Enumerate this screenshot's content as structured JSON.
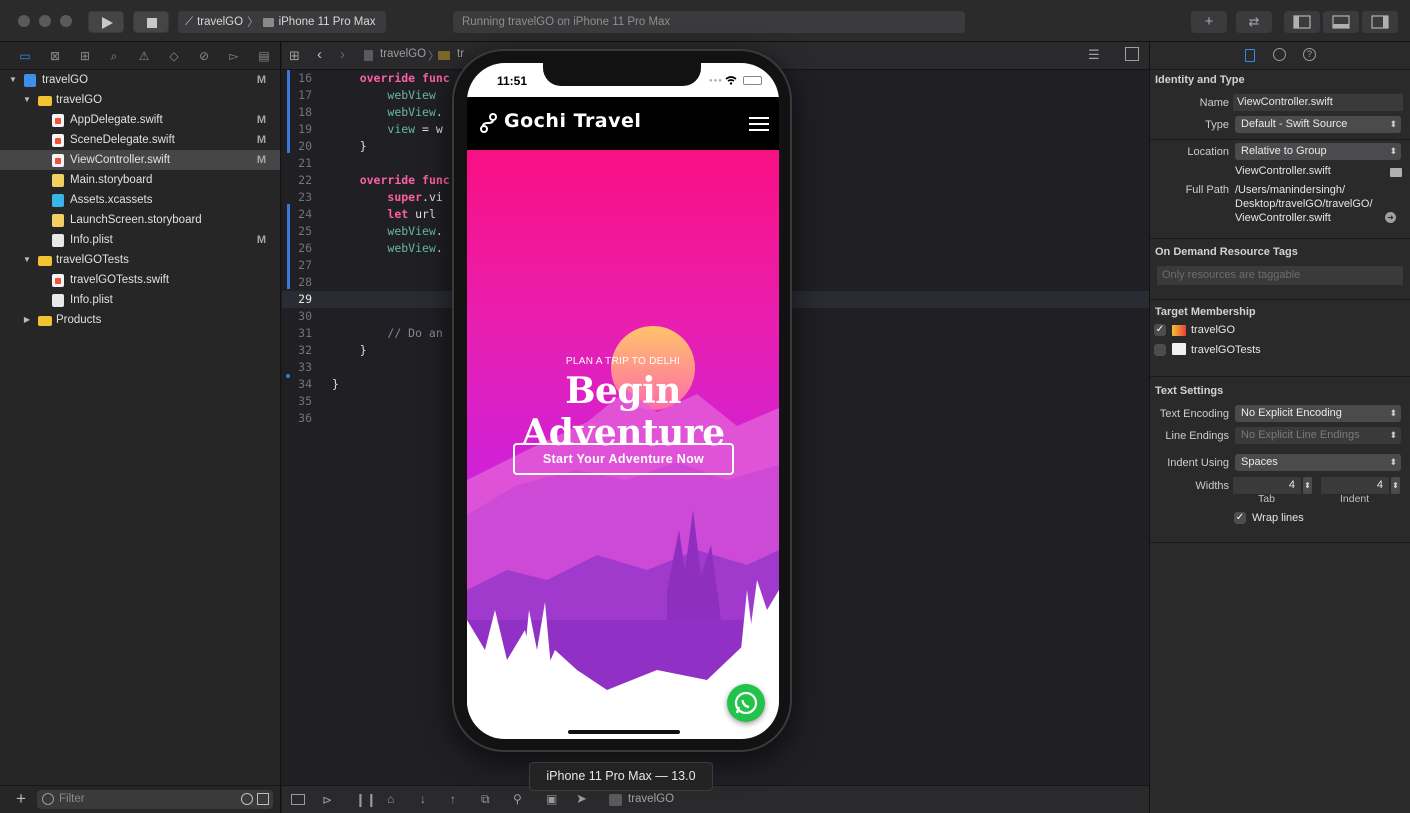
{
  "toolbar": {
    "scheme_project": "travelGO",
    "scheme_device": "iPhone 11 Pro Max",
    "activity_text": "Running travelGO on iPhone 11 Pro Max",
    "library_icon": "plus-icon",
    "review_icon": "arrows-swap-icon"
  },
  "navigator": {
    "tree": [
      {
        "label": "travelGO",
        "indent": 0,
        "icon": "project-icon",
        "expanded": true,
        "badge": "M",
        "selected": false
      },
      {
        "label": "travelGO",
        "indent": 1,
        "icon": "folder-icon",
        "expanded": true,
        "badge": "",
        "selected": false
      },
      {
        "label": "AppDelegate.swift",
        "indent": 2,
        "icon": "swift-file-icon",
        "badge": "M",
        "selected": false
      },
      {
        "label": "SceneDelegate.swift",
        "indent": 2,
        "icon": "swift-file-icon",
        "badge": "M",
        "selected": false
      },
      {
        "label": "ViewController.swift",
        "indent": 2,
        "icon": "swift-file-icon",
        "badge": "M",
        "selected": true
      },
      {
        "label": "Main.storyboard",
        "indent": 2,
        "icon": "storyboard-file-icon",
        "badge": "",
        "selected": false
      },
      {
        "label": "Assets.xcassets",
        "indent": 2,
        "icon": "assets-folder-icon",
        "badge": "",
        "selected": false
      },
      {
        "label": "LaunchScreen.storyboard",
        "indent": 2,
        "icon": "storyboard-file-icon",
        "badge": "",
        "selected": false
      },
      {
        "label": "Info.plist",
        "indent": 2,
        "icon": "plist-file-icon",
        "badge": "M",
        "selected": false
      },
      {
        "label": "travelGOTests",
        "indent": 1,
        "icon": "folder-icon",
        "expanded": true,
        "badge": "",
        "selected": false
      },
      {
        "label": "travelGOTests.swift",
        "indent": 2,
        "icon": "swift-file-icon",
        "badge": "",
        "selected": false
      },
      {
        "label": "Info.plist",
        "indent": 2,
        "icon": "plist-file-icon",
        "badge": "",
        "selected": false
      },
      {
        "label": "Products",
        "indent": 1,
        "icon": "folder-icon",
        "expanded": false,
        "badge": "",
        "selected": false
      }
    ],
    "filter_placeholder": "Filter"
  },
  "editor": {
    "jump_bar": [
      "travelGO",
      "tr"
    ],
    "current_line": 29,
    "lines": [
      {
        "no": "16",
        "html": "    <span class=\"kw\">override</span> <span class=\"kw\">func</span>"
      },
      {
        "no": "17",
        "html": "        <span class=\"ty\">webView</span>"
      },
      {
        "no": "18",
        "html": "        <span class=\"ty\">webView</span>."
      },
      {
        "no": "19",
        "html": "        <span class=\"ty\">view</span> = w"
      },
      {
        "no": "20",
        "html": "    }"
      },
      {
        "no": "21",
        "html": ""
      },
      {
        "no": "22",
        "html": "    <span class=\"kw\">override</span> <span class=\"kw\">func</span>"
      },
      {
        "no": "23",
        "html": "        <span class=\"kw\">super</span>.vi"
      },
      {
        "no": "24",
        "html": "        <span class=\"kw\">let</span> url                                                 )!"
      },
      {
        "no": "25",
        "html": "        <span class=\"ty\">webView</span>."
      },
      {
        "no": "26",
        "html": "        <span class=\"ty\">webView</span>."
      },
      {
        "no": "27",
        "html": ""
      },
      {
        "no": "28",
        "html": ""
      },
      {
        "no": "29",
        "html": ""
      },
      {
        "no": "30",
        "html": ""
      },
      {
        "no": "31",
        "html": "        <span class=\"cm\">// Do an</span>"
      },
      {
        "no": "32",
        "html": "    }"
      },
      {
        "no": "33",
        "html": ""
      },
      {
        "no": "34",
        "html": "}"
      },
      {
        "no": "35",
        "html": ""
      },
      {
        "no": "36",
        "html": ""
      }
    ],
    "debug_target": "travelGO"
  },
  "simulator": {
    "time": "11:51",
    "app_title": "Gochi Travel",
    "hero_subtitle": "PLAN A TRIP TO DELHI",
    "hero_title": "Begin Adventure",
    "hero_button": "Start Your Adventure Now",
    "device_label": "iPhone 11 Pro Max — 13.0",
    "colors": {
      "header_bg": "#000000",
      "gradient_top": "#f90f83",
      "gradient_bottom": "#8b1ec4",
      "whatsapp": "#22c24b"
    }
  },
  "inspector": {
    "identity_title": "Identity and Type",
    "name_label": "Name",
    "name_value": "ViewController.swift",
    "type_label": "Type",
    "type_value": "Default - Swift Source",
    "location_label": "Location",
    "location_value": "Relative to Group",
    "location_file": "ViewController.swift",
    "full_path_label": "Full Path",
    "full_path_value": [
      "/Users/manindersingh/",
      "Desktop/travelGO/travelGO/",
      "ViewController.swift"
    ],
    "odr_title": "On Demand Resource Tags",
    "odr_placeholder": "Only resources are taggable",
    "target_title": "Target Membership",
    "targets": [
      {
        "name": "travelGO",
        "checked": true
      },
      {
        "name": "travelGOTests",
        "checked": false
      }
    ],
    "text_settings_title": "Text Settings",
    "encoding_label": "Text Encoding",
    "encoding_value": "No Explicit Encoding",
    "line_endings_label": "Line Endings",
    "line_endings_value": "No Explicit Line Endings",
    "indent_using_label": "Indent Using",
    "indent_using_value": "Spaces",
    "widths_label": "Widths",
    "tab_width": "4",
    "indent_width": "4",
    "tab_caption": "Tab",
    "indent_caption": "Indent",
    "wrap_lines_label": "Wrap lines",
    "wrap_lines_checked": true
  }
}
